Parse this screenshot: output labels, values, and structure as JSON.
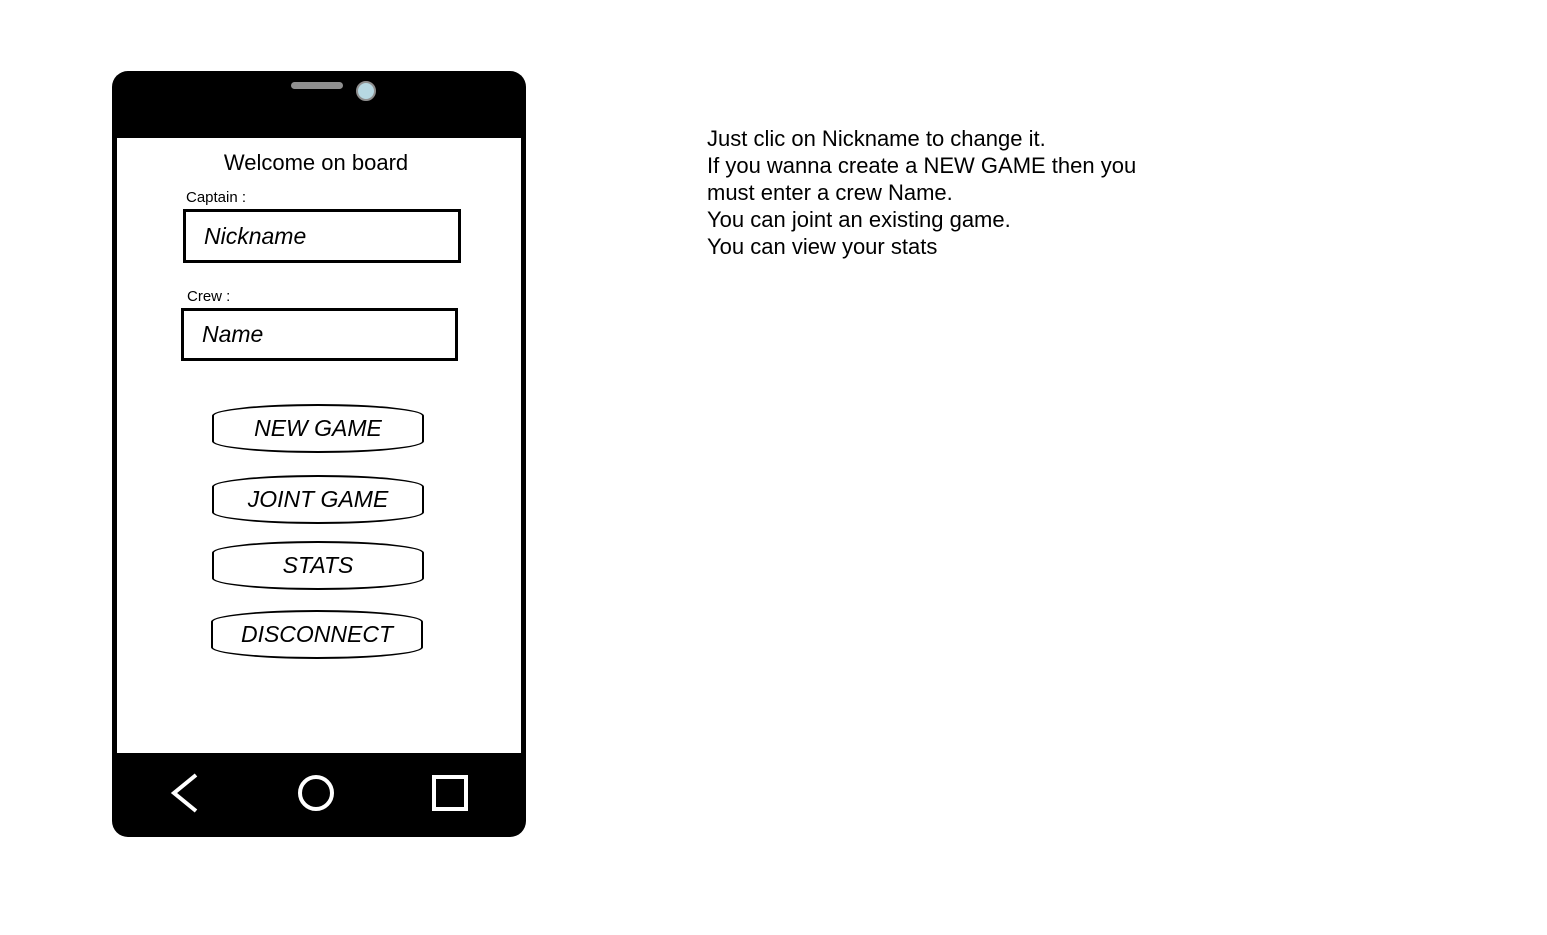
{
  "screen": {
    "title": "Welcome on board",
    "captain": {
      "label": "Captain :",
      "value": "Nickname"
    },
    "crew": {
      "label": "Crew :",
      "value": "Name"
    },
    "buttons": {
      "new_game": "NEW GAME",
      "join_game": "JOINT GAME",
      "stats": "STATS",
      "disconnect": "DISCONNECT"
    }
  },
  "navbar": {
    "back_icon": "chevron-left",
    "home_icon": "circle",
    "recents_icon": "square"
  },
  "notes": {
    "lines": [
      "Just clic on Nickname to change it.",
      "If you wanna create a NEW GAME then you",
      "must enter a crew Name.",
      "You can joint an existing game.",
      "You can view your stats"
    ]
  },
  "colors": {
    "phone_body": "#000000",
    "camera": "#b7d8e2",
    "speaker": "#8f8f8f"
  }
}
